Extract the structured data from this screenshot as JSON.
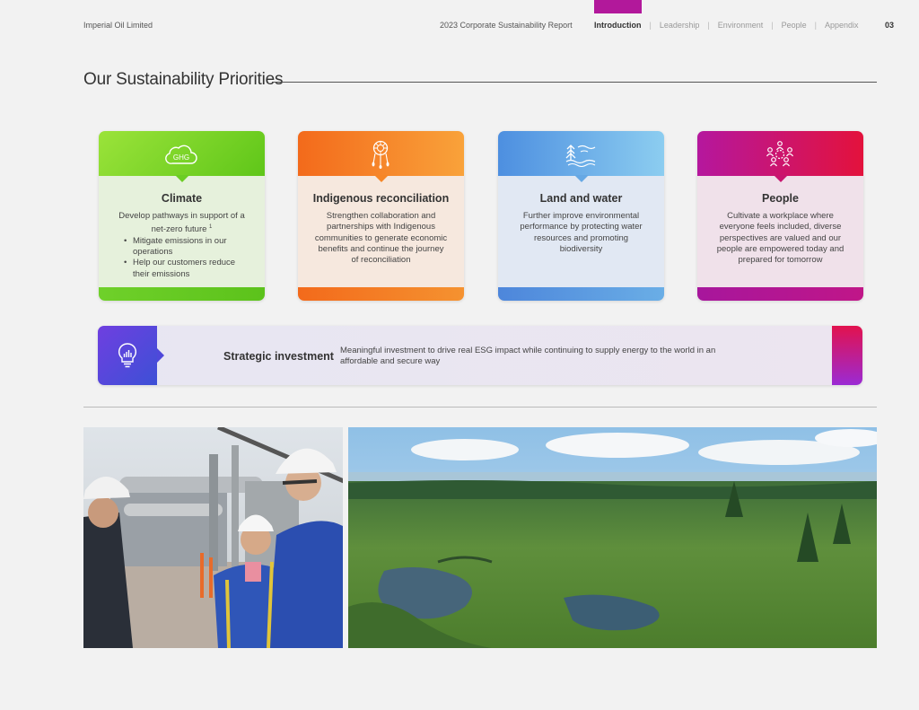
{
  "header": {
    "company": "Imperial Oil Limited",
    "report": "2023 Corporate Sustainability Report",
    "nav": [
      {
        "label": "Introduction",
        "active": true
      },
      {
        "label": "Leadership",
        "active": false
      },
      {
        "label": "Environment",
        "active": false
      },
      {
        "label": "People",
        "active": false
      },
      {
        "label": "Appendix",
        "active": false
      }
    ],
    "separator": "|",
    "page_number": "03",
    "active_color": "#b2189b"
  },
  "page_title": "Our Sustainability Priorities",
  "cards": {
    "climate": {
      "icon": "ghg-cloud-icon",
      "icon_text": "GHG",
      "title": "Climate",
      "desc": "Develop pathways in support of a net-zero future",
      "footnote": "1",
      "bullets": [
        "Mitigate emissions in our operations",
        "Help our customers reduce their emissions"
      ],
      "color": "#5fc619"
    },
    "indigenous": {
      "icon": "dreamcatcher-icon",
      "title": "Indigenous reconciliation",
      "desc": "Strengthen collaboration and partnerships with Indigenous communities to generate economic benefits and continue the journey of reconciliation",
      "color": "#f36a1b"
    },
    "land": {
      "icon": "tree-water-icon",
      "title": "Land and water",
      "desc": "Further improve environmental performance by protecting water resources and promoting biodiversity",
      "color": "#4d8fe0"
    },
    "people": {
      "icon": "people-network-icon",
      "title": "People",
      "desc": "Cultivate a workplace where everyone feels included, diverse perspectives are valued and our people are empowered today and prepared for tomorrow",
      "color": "#b5179e"
    }
  },
  "strategic": {
    "icon": "lightbulb-chart-icon",
    "title": "Strategic investment",
    "desc": "Meaningful investment to drive real ESG impact while continuing to supply energy to the world in an affordable and secure way",
    "color": "#5a46dc"
  },
  "photos": {
    "left": "photo-workers-at-facility",
    "right": "photo-boreal-forest-landscape"
  }
}
